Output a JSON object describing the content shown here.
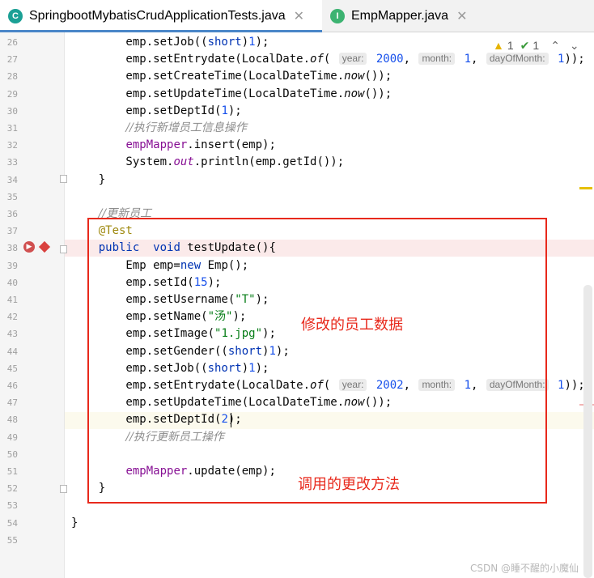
{
  "tabs": [
    {
      "label": "SpringbootMybatisCrudApplicationTests.java",
      "active": true,
      "icon_name": "test-class-icon",
      "icon_color": "#1ba095"
    },
    {
      "label": "EmpMapper.java",
      "active": false,
      "icon_name": "interface-icon",
      "icon_color": "#3cb371"
    }
  ],
  "inspections": {
    "warnings": "1",
    "checks": "1"
  },
  "line_numbers": [
    "26",
    "27",
    "28",
    "29",
    "30",
    "31",
    "32",
    "33",
    "34",
    "35",
    "36",
    "37",
    "38",
    "39",
    "40",
    "41",
    "42",
    "43",
    "44",
    "45",
    "46",
    "47",
    "48",
    "49",
    "50",
    "51",
    "52",
    "53",
    "54",
    "55"
  ],
  "code_lines": [
    "        emp.setJob((short)1);",
    "        emp.setEntrydate(LocalDate.of( year: 2000, month: 1, dayOfMonth: 1));",
    "        emp.setCreateTime(LocalDateTime.now());",
    "        emp.setUpdateTime(LocalDateTime.now());",
    "        emp.setDeptId(1);",
    "        //执行新增员工信息操作",
    "        empMapper.insert(emp);",
    "        System.out.println(emp.getId());",
    "    }",
    "",
    "    //更新员工",
    "    @Test",
    "    public  void testUpdate(){",
    "        Emp emp=new Emp();",
    "        emp.setId(15);",
    "        emp.setUsername(\"T\");",
    "        emp.setName(\"汤\");",
    "        emp.setImage(\"1.jpg\");",
    "        emp.setGender((short)1);",
    "        emp.setJob((short)1);",
    "        emp.setEntrydate(LocalDate.of( year: 2002, month: 1, dayOfMonth: 1));",
    "        emp.setUpdateTime(LocalDateTime.now());",
    "        emp.setDeptId(2);",
    "        //执行更新员工操作",
    "",
    "        empMapper.update(emp);",
    "    }",
    "",
    "}",
    ""
  ],
  "annotations": {
    "note_modify": "修改的员工数据",
    "note_update": "调用的更改方法"
  },
  "watermark": "CSDN @睡不醒的小魔仙",
  "colors": {
    "highlight_box": "#e8291c",
    "tab_accent": "#4a86c8"
  }
}
